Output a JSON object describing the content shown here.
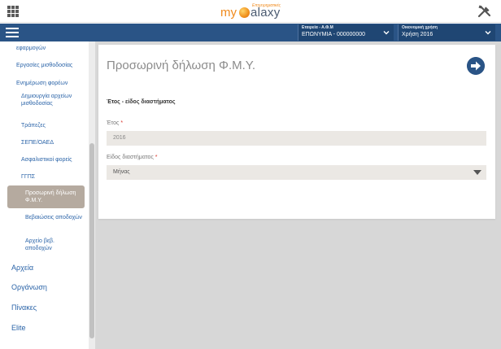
{
  "header": {
    "logo_my": "my",
    "logo_alaxy": "alaxy",
    "logo_sub": "Επιχειρηματικές"
  },
  "navbar": {
    "company_label": "Εταιρεία - Α.Φ.Μ",
    "company_value": "ΕΠΩΝΥΜΙΑ - 000000000",
    "year_label": "Οικονομική χρήση",
    "year_value": "Χρήση 2016"
  },
  "sidebar": {
    "items": [
      "εφαρμογών",
      "Εργασίες μισθοδοσίας",
      "Ενημέρωση φορέων",
      "Δημιουργία αρχείων μισθοδοσίας",
      "Τράπεζες",
      "ΣΕΠΕ/ΟΑΕΔ",
      "Ασφαλιστικοί φορείς",
      "ΓΓΠΣ",
      "Προσωρινή δήλωση Φ.Μ.Υ.",
      "Βεβαιώσεις αποδοχών",
      "Αρχείο βεβ. αποδοχών"
    ],
    "main_items": [
      "Αρχεία",
      "Οργάνωση",
      "Πίνακες",
      "Elite"
    ]
  },
  "page": {
    "title": "Προσωρινή δήλωση Φ.Μ.Υ.",
    "section_title": "Έτος - είδος διαστήματος",
    "year_label": "Έτος",
    "year_value": "2016",
    "period_label": "Είδος διαστήματος",
    "period_value": "Μήνας",
    "required_mark": "*"
  },
  "colors": {
    "navbar": "#2a5486",
    "link": "#2b64a8",
    "active_item": "#b5aa9f",
    "input_bg": "#ebe8e4",
    "required": "#d9342b"
  }
}
